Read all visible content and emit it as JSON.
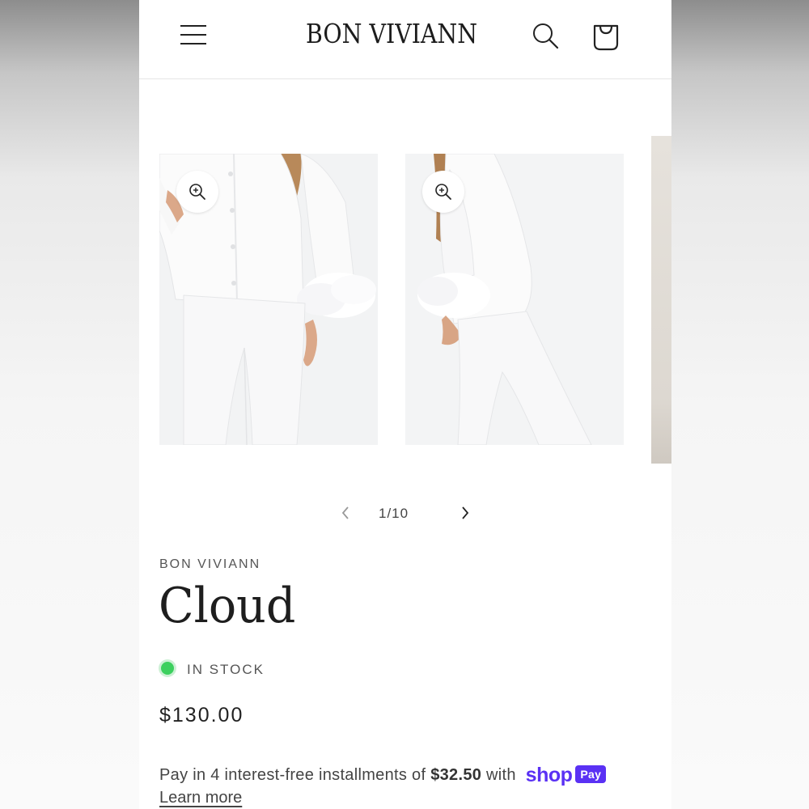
{
  "header": {
    "brand": "BON VIVIANN",
    "menu_icon": "hamburger-menu-icon",
    "search_icon": "search-icon",
    "cart_icon": "shopping-bag-icon"
  },
  "gallery": {
    "slides": [
      {
        "alt": "woman in white satin pajama set with feather cuffs, front view",
        "zoom_icon": "zoom-in-icon"
      },
      {
        "alt": "woman in white satin pajama set with feather cuffs, side view",
        "zoom_icon": "zoom-in-icon"
      },
      {
        "alt": "partial next slide"
      }
    ],
    "counter": "1/10",
    "prev_icon": "chevron-left-icon",
    "next_icon": "chevron-right-icon"
  },
  "product": {
    "vendor": "BON VIVIANN",
    "title": "Cloud",
    "stock_status": "IN STOCK",
    "stock_color": "#3cd05e",
    "price": "$130.00"
  },
  "installments": {
    "prefix": "Pay in 4 interest-free installments of",
    "amount": "$32.50",
    "suffix": "with",
    "shop_logo": "shop",
    "pay_badge": "Pay",
    "learn_more": "Learn more",
    "brand_color": "#5a31f4"
  }
}
